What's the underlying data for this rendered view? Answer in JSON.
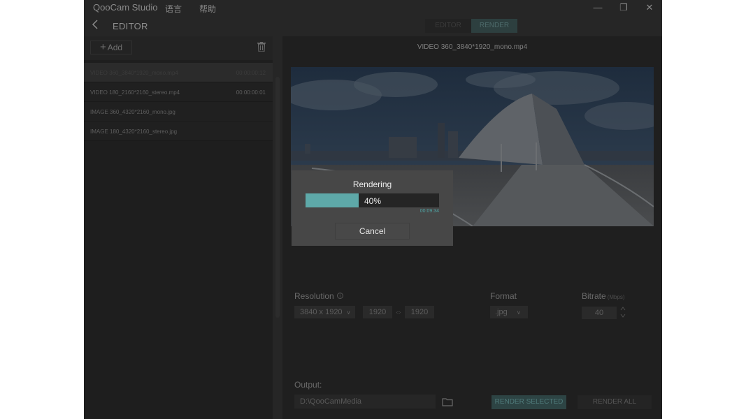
{
  "titlebar": {
    "app_name": "QooCam Studio",
    "menu": [
      "语言",
      "帮助"
    ],
    "minimize_glyph": "—",
    "restore_glyph": "❐",
    "close_glyph": "✕"
  },
  "editor": {
    "title": "EDITOR"
  },
  "mode_tabs": [
    {
      "label": "EDITOR",
      "active": false
    },
    {
      "label": "RENDER",
      "active": true
    }
  ],
  "left_panel": {
    "add_label": "Add",
    "files": [
      {
        "name": "VIDEO 360_3840*1920_mono.mp4",
        "duration": "00:00:00:12",
        "selected": true
      },
      {
        "name": "VIDEO 180_2160*2160_stereo.mp4",
        "duration": "00:00:00:01",
        "selected": false
      },
      {
        "name": "IMAGE 360_4320*2160_mono.jpg",
        "duration": "",
        "selected": false
      },
      {
        "name": "IMAGE 180_4320*2160_stereo.jpg",
        "duration": "",
        "selected": false
      }
    ]
  },
  "right_panel": {
    "file_title": "VIDEO 360_3840*1920_mono.mp4",
    "resolution": {
      "label": "Resolution",
      "selected": "3840 x 1920",
      "width": "1920",
      "height": "1920",
      "link_glyph": "⇔"
    },
    "format": {
      "label": "Format",
      "selected": ".jpg"
    },
    "bitrate": {
      "label": "Bitrate",
      "unit": "(Mbps)",
      "value": "40"
    },
    "output": {
      "label": "Output:",
      "path": "D:\\QooCamMedia"
    },
    "render_selected_label": "RENDER SELECTED",
    "render_all_label": "RENDER ALL"
  },
  "modal": {
    "title": "Rendering",
    "progress_percent": 40,
    "progress_text": "40%",
    "time": "00:09:34",
    "cancel_label": "Cancel"
  },
  "colors": {
    "accent": "#5ea9a9",
    "modal_bg": "#474747",
    "app_bg": "#262626"
  }
}
